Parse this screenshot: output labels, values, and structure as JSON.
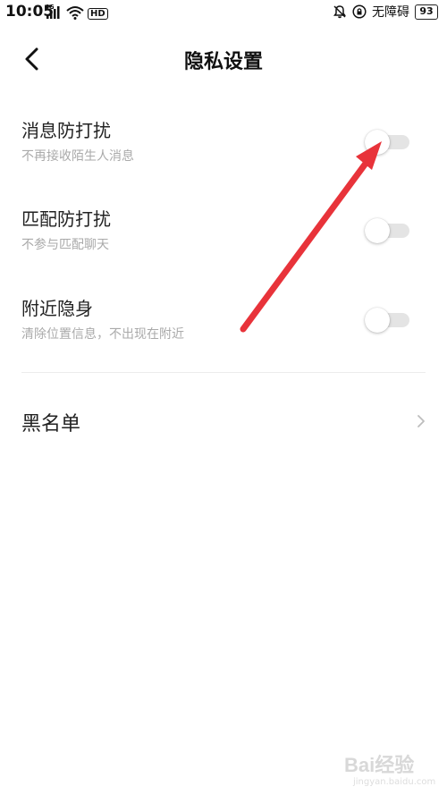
{
  "status_bar": {
    "time": "10:05",
    "signal_label": "4G",
    "hd_label": "HD",
    "accessibility_text": "无障碍",
    "battery": "93"
  },
  "header": {
    "title": "隐私设置"
  },
  "settings": [
    {
      "title": "消息防打扰",
      "subtitle": "不再接收陌生人消息",
      "enabled": false
    },
    {
      "title": "匹配防打扰",
      "subtitle": "不参与匹配聊天",
      "enabled": false
    },
    {
      "title": "附近隐身",
      "subtitle": "清除位置信息，不出现在附近",
      "enabled": false
    }
  ],
  "blacklist": {
    "label": "黑名单"
  },
  "watermark": {
    "main": "Bai经验",
    "sub": "jingyan.baidu.com"
  },
  "colors": {
    "annotation_arrow": "#e8333a",
    "toggle_track_off": "#e4e4e4",
    "subtitle_gray": "#aaaaaa"
  }
}
